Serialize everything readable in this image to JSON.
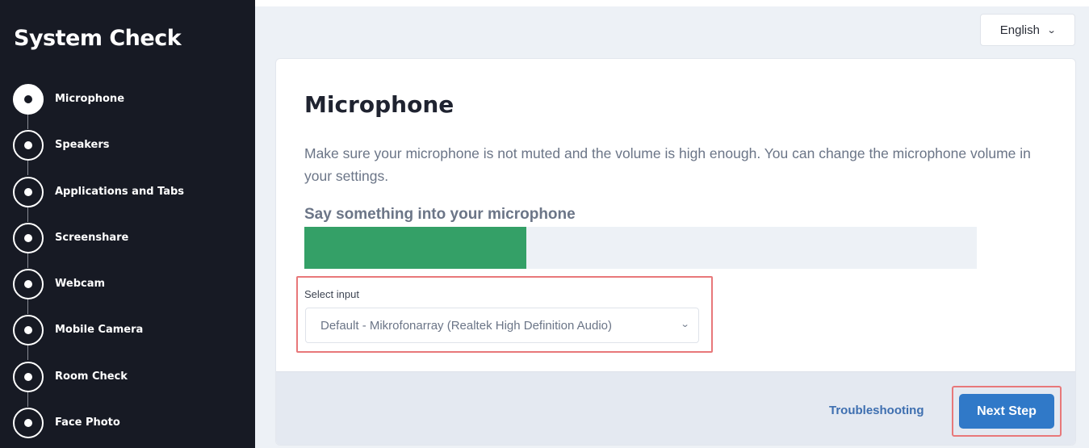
{
  "sidebar": {
    "title": "System Check",
    "steps": [
      {
        "label": "Microphone",
        "active": true
      },
      {
        "label": "Speakers",
        "active": false
      },
      {
        "label": "Applications and Tabs",
        "active": false
      },
      {
        "label": "Screenshare",
        "active": false
      },
      {
        "label": "Webcam",
        "active": false
      },
      {
        "label": "Mobile Camera",
        "active": false
      },
      {
        "label": "Room Check",
        "active": false
      },
      {
        "label": "Face Photo",
        "active": false
      }
    ]
  },
  "header": {
    "language": "English"
  },
  "card": {
    "title": "Microphone",
    "description": "Make sure your microphone is not muted and the volume is high enough. You can change the microphone volume in your settings.",
    "prompt": "Say something into your microphone",
    "meter_level": 0.33,
    "select_label": "Select input",
    "select_value": "Default - Mikrofonarray (Realtek High Definition Audio)",
    "troubleshooting": "Troubleshooting",
    "next": "Next Step"
  },
  "colors": {
    "sidebar_bg": "#171a24",
    "meter": "#34a067",
    "primary": "#3079c8",
    "highlight": "#e8787a"
  }
}
